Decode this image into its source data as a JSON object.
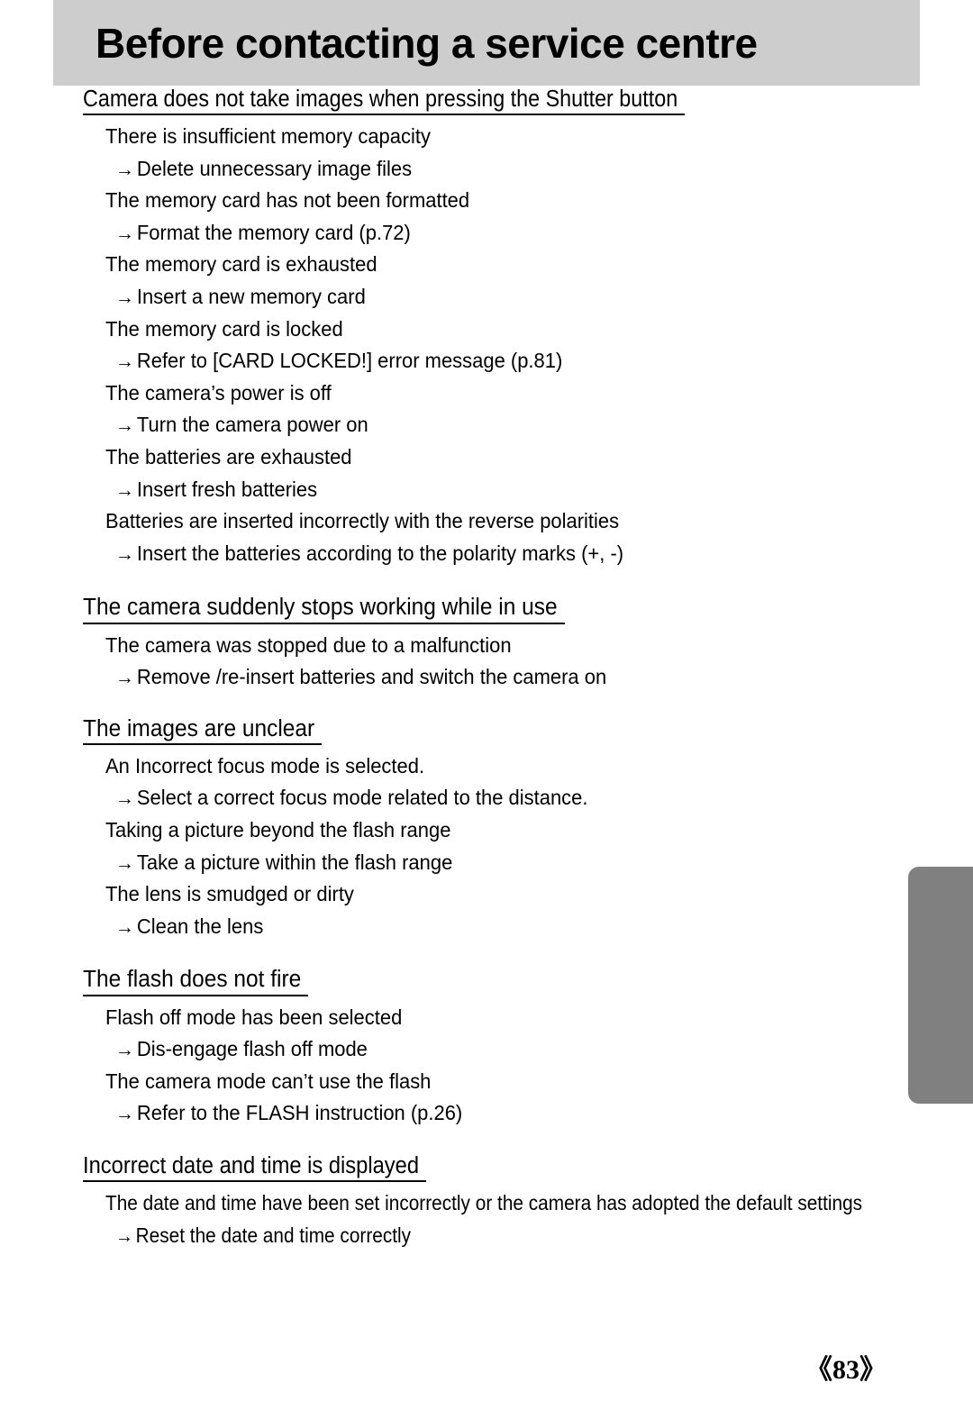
{
  "page": {
    "title": "Before contacting a service centre",
    "page_number": "《83》",
    "header_bg": "#cdcdcd",
    "edge_tab_color": "#808080",
    "text_color": "#000000"
  },
  "arrow_glyph": "→",
  "sections": [
    {
      "id": "shutter",
      "heading": "Camera does not take images when pressing the Shutter button",
      "items": [
        {
          "cause": "There is insufficient memory capacity",
          "remedy": "Delete unnecessary image files"
        },
        {
          "cause": "The memory card has not been formatted",
          "remedy": "Format the memory card (p.72)"
        },
        {
          "cause": "The memory card is exhausted",
          "remedy": "Insert a new memory card"
        },
        {
          "cause": "The memory card is locked",
          "remedy": "Refer to [CARD LOCKED!] error message (p.81)"
        },
        {
          "cause": "The camera’s power is off",
          "remedy": "Turn the camera power on"
        },
        {
          "cause": "The batteries are exhausted",
          "remedy": "Insert fresh batteries"
        },
        {
          "cause": "Batteries are inserted incorrectly with the reverse polarities",
          "remedy": "Insert the batteries according to the polarity marks (+, -)"
        }
      ]
    },
    {
      "id": "stops",
      "heading": "The camera suddenly stops working while in use",
      "items": [
        {
          "cause": "The camera was stopped due to a malfunction",
          "remedy": "Remove /re-insert batteries and switch the camera on"
        }
      ]
    },
    {
      "id": "unclear",
      "heading": "The images are unclear",
      "items": [
        {
          "cause": "An Incorrect focus mode is selected.",
          "remedy": "Select a correct focus mode related to the distance."
        },
        {
          "cause": "Taking a picture beyond the flash range",
          "remedy": "Take a picture within the flash range"
        },
        {
          "cause": "The lens is smudged or dirty",
          "remedy": "Clean the lens"
        }
      ]
    },
    {
      "id": "flash",
      "heading": "The flash does not fire",
      "items": [
        {
          "cause": "Flash off mode has been selected",
          "remedy": "Dis-engage flash off mode"
        },
        {
          "cause": "The camera mode can’t use the flash",
          "remedy": "Refer to the FLASH instruction (p.26)"
        }
      ]
    },
    {
      "id": "datetime",
      "heading": "Incorrect date and time is displayed",
      "items": [
        {
          "cause": "The date and time have been set incorrectly or the camera has adopted the default settings",
          "remedy": "Reset the date and time correctly"
        }
      ]
    }
  ]
}
